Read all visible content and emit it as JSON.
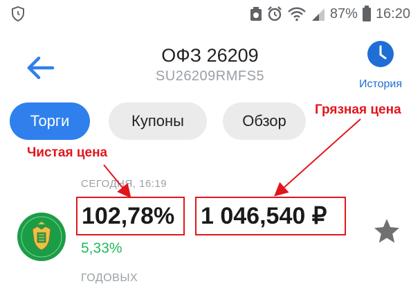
{
  "status": {
    "battery_percent": "87%",
    "time": "16:20",
    "icons": [
      "shield-icon",
      "photo-notification-icon",
      "alarm-icon",
      "wifi-icon",
      "cellular-signal-icon",
      "battery-icon"
    ]
  },
  "header": {
    "title": "ОФЗ 26209",
    "subtitle": "SU26209RMFS5",
    "history_label": "История"
  },
  "tabs": [
    {
      "label": "Торги",
      "active": true
    },
    {
      "label": "Купоны",
      "active": false
    },
    {
      "label": "Обзор",
      "active": false
    }
  ],
  "annotations": {
    "clean_price": "Чистая цена",
    "dirty_price": "Грязная цена"
  },
  "quote": {
    "time_label": "СЕГОДНЯ, 16:19",
    "clean_price": "102,78%",
    "dirty_price": "1 046,540 ₽",
    "yield": "5,33%",
    "yield_label": "ГОДОВЫХ"
  },
  "colors": {
    "accent": "#2f80ed",
    "annotation": "#e2151b",
    "yield": "#21b95a",
    "muted": "#9aa0a6"
  }
}
